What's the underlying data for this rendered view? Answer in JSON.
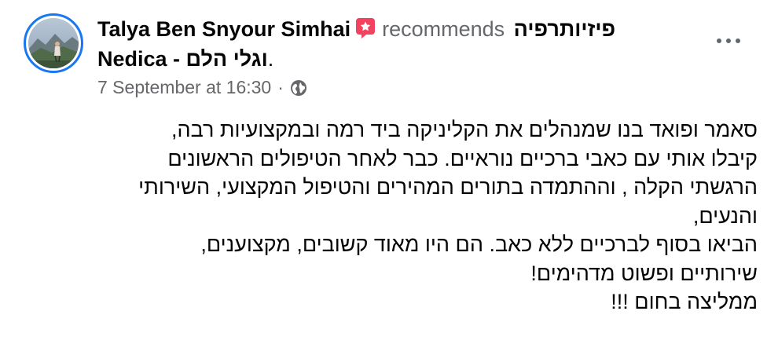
{
  "post": {
    "author": "Talya Ben Snyour Simhai",
    "verb": "recommends",
    "page_name": "פיזיותרפיה - וגלי הלם Nedica",
    "page_name_part1": "פיזיותרפיה",
    "page_name_part2": "וגלי הלם - Nedica",
    "page_name_end": ".",
    "timestamp": "7 September at 16:30",
    "separator": "·",
    "privacy_icon": "globe-icon",
    "recommend_icon": "recommend-flag-icon",
    "more_icon": "more-options-icon",
    "body_lines": [
      "סאמר ופואד בנו שמנהלים את הקליניקה ביד רמה ובמקצועיות רבה,",
      "קיבלו אותי עם כאבי ברכיים נוראיים. כבר לאחר הטיפולים הראשונים",
      "הרגשתי הקלה , וההתמדה בתורים המהירים והטיפול המקצועי, השירותי",
      "והנעים,",
      "הביאו בסוף לברכיים ללא כאב. הם היו מאוד קשובים, מקצוענים,",
      "שירותיים ופשוט מדהימים!",
      "ממליצה בחום !!!"
    ]
  },
  "colors": {
    "accent_blue": "#1877f2",
    "secondary_text": "#65676b",
    "recommend_pink": "#f3425f",
    "primary_text": "#050505"
  }
}
